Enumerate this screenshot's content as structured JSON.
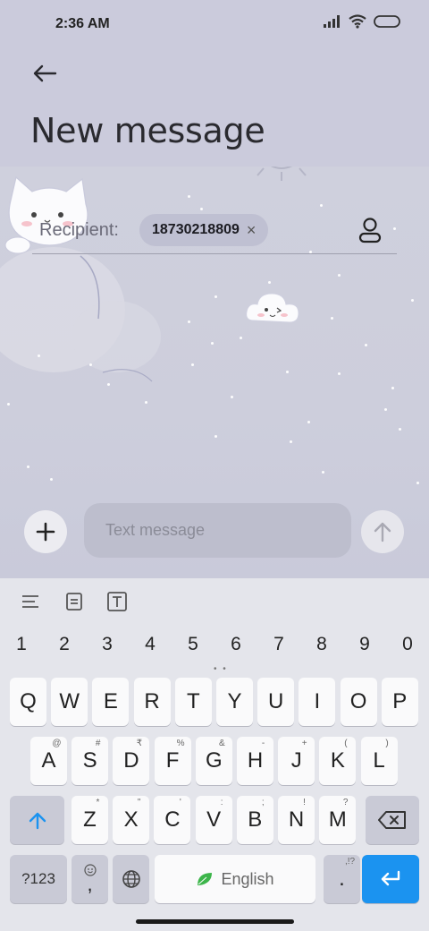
{
  "status_bar": {
    "time": "2:36 AM"
  },
  "header": {
    "title": "New message"
  },
  "recipient": {
    "label": "Recipient:",
    "chip_number": "18730218809",
    "chip_remove": "×"
  },
  "composer": {
    "placeholder": "Text message"
  },
  "keyboard": {
    "numbers": [
      "1",
      "2",
      "3",
      "4",
      "5",
      "6",
      "7",
      "8",
      "9",
      "0"
    ],
    "row1": [
      "Q",
      "W",
      "E",
      "R",
      "T",
      "Y",
      "U",
      "I",
      "O",
      "P"
    ],
    "row2": [
      "A",
      "S",
      "D",
      "F",
      "G",
      "H",
      "J",
      "K",
      "L"
    ],
    "row2_hints": [
      "@",
      "#",
      "₹",
      "%",
      "&",
      "-",
      "+",
      "(",
      ")"
    ],
    "row3": [
      "Z",
      "X",
      "C",
      "V",
      "B",
      "N",
      "M"
    ],
    "row3_hints": [
      "*",
      "\"",
      "'",
      ":",
      ";",
      "!",
      "?"
    ],
    "symbols_label": "?123",
    "comma_label": ",",
    "space_label": "English",
    "period_label": ".",
    "period_hint": ",!?"
  },
  "colors": {
    "accent": "#1b93f0",
    "background": "#cfd0de"
  }
}
